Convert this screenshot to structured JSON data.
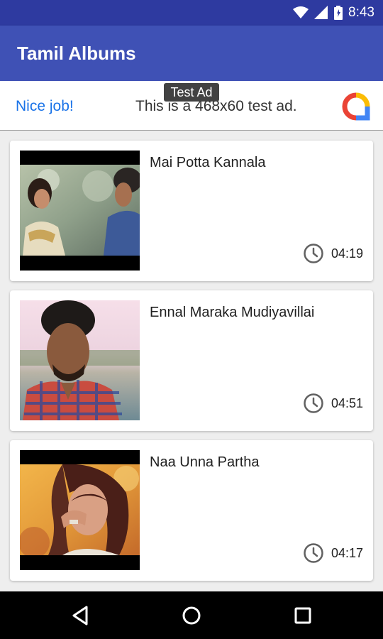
{
  "status_bar": {
    "time": "8:43"
  },
  "app_bar": {
    "title": "Tamil Albums"
  },
  "ad": {
    "tag": "Test Ad",
    "nice": "Nice job!",
    "text": "This is a 468x60 test ad."
  },
  "albums": [
    {
      "title": "Mai Potta Kannala",
      "duration": "04:19"
    },
    {
      "title": "Ennal Maraka Mudiyavillai",
      "duration": "04:51"
    },
    {
      "title": "Naa Unna Partha",
      "duration": "04:17"
    }
  ]
}
